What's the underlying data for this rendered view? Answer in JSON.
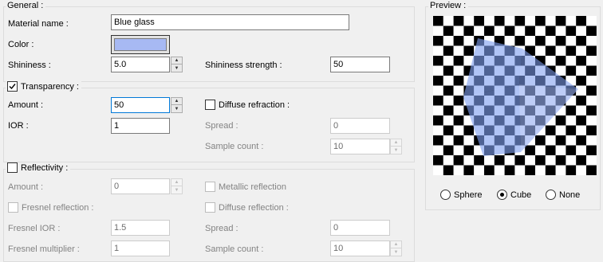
{
  "general": {
    "legend": "General :",
    "material_name_label": "Material name :",
    "material_name_value": "Blue glass",
    "color_label": "Color :",
    "color_value": "#a7b9f3",
    "shininess_label": "Shininess :",
    "shininess_value": "5.0",
    "shininess_strength_label": "Shininess strength :",
    "shininess_strength_value": "50"
  },
  "transparency": {
    "legend": "Transparency :",
    "checked": true,
    "amount_label": "Amount :",
    "amount_value": "50",
    "diffuse_refraction_label": "Diffuse refraction :",
    "ior_label": "IOR :",
    "ior_value": "1",
    "spread_label": "Spread :",
    "spread_value": "0",
    "sample_count_label": "Sample count :",
    "sample_count_value": "10"
  },
  "reflectivity": {
    "legend": "Reflectivity :",
    "checked": false,
    "amount_label": "Amount :",
    "amount_value": "0",
    "metallic_reflection_label": "Metallic reflection",
    "fresnel_reflection_label": "Fresnel reflection :",
    "diffuse_reflection_label": "Diffuse reflection :",
    "fresnel_ior_label": "Fresnel IOR :",
    "fresnel_ior_value": "1.5",
    "spread_label": "Spread :",
    "spread_value": "0",
    "fresnel_multiplier_label": "Fresnel multiplier :",
    "fresnel_multiplier_value": "1",
    "sample_count_label": "Sample count :",
    "sample_count_value": "10"
  },
  "preview": {
    "legend": "Preview :",
    "options": [
      "Sphere",
      "Cube",
      "None"
    ],
    "selected": "Cube",
    "cube_color": "#7f9ff0"
  },
  "icons": {
    "check": "check-mark-icon",
    "spin_up": "spin-up-icon",
    "spin_down": "spin-down-icon"
  }
}
